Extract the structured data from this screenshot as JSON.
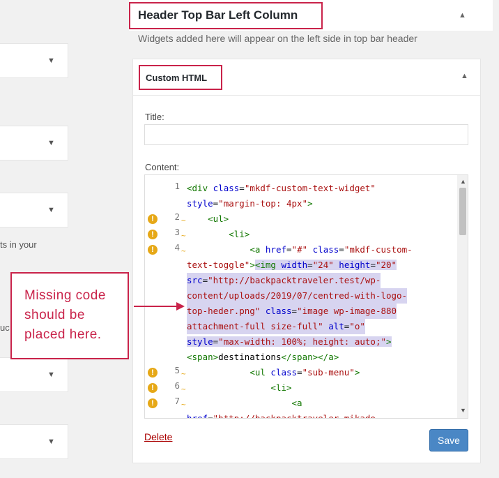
{
  "left_column": {
    "note_1": "ts in your",
    "note_2": "uc"
  },
  "sidebar_area": {
    "title": "Header Top Bar Left Column",
    "description": "Widgets added here will appear on the left side in top bar header"
  },
  "widget": {
    "title": "Custom HTML",
    "title_label": "Title:",
    "title_value": "",
    "content_label": "Content:",
    "delete_label": "Delete",
    "save_label": "Save"
  },
  "code_lines": [
    {
      "num": "1",
      "warn": false,
      "text": "<div class=\"mkdf-custom-text-widget\""
    },
    {
      "num": "",
      "warn": false,
      "text": "style=\"margin-top: 4px\">"
    },
    {
      "num": "2",
      "warn": true,
      "text": "    <ul>"
    },
    {
      "num": "3",
      "warn": true,
      "text": "        <li>"
    },
    {
      "num": "4",
      "warn": true,
      "text": "            <a href=\"#\" class=\"mkdf-custom-"
    },
    {
      "num": "",
      "warn": false,
      "text": "text-toggle\"><img width=\"24\" height=\"20\""
    },
    {
      "num": "",
      "warn": false,
      "text": "src=\"http://backpacktraveler.test/wp-"
    },
    {
      "num": "",
      "warn": false,
      "text": "content/uploads/2019/07/centred-with-logo-"
    },
    {
      "num": "",
      "warn": false,
      "text": "top-heder.png\" class=\"image wp-image-880"
    },
    {
      "num": "",
      "warn": false,
      "text": "attachment-full size-full\" alt=\"o\""
    },
    {
      "num": "",
      "warn": false,
      "text": "style=\"max-width: 100%; height: auto;\">"
    },
    {
      "num": "",
      "warn": false,
      "text": "<span>destinations</span></a>"
    },
    {
      "num": "5",
      "warn": true,
      "text": "            <ul class=\"sub-menu\">"
    },
    {
      "num": "6",
      "warn": true,
      "text": "                <li>"
    },
    {
      "num": "7",
      "warn": true,
      "text": "                    <a"
    },
    {
      "num": "",
      "warn": false,
      "text": "href=\"http://backpacktraveler.mikado-"
    }
  ],
  "callout": {
    "text": "Missing code should be placed here."
  },
  "colors": {
    "annotation": "#c9234a",
    "save_button": "#4a87c5",
    "warning": "#e6a817",
    "selection": "#d7d4f0"
  },
  "icons": {
    "collapse": "triangle-up",
    "expand": "triangle-down",
    "warning": "exclamation-circle"
  }
}
